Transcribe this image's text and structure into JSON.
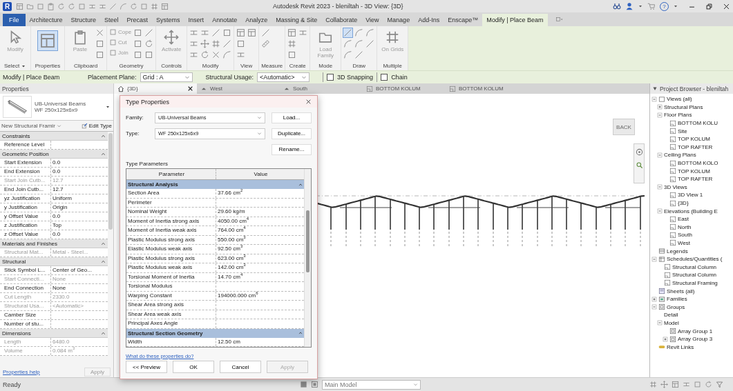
{
  "title_bar": {
    "logo": "R",
    "title": "Autodesk Revit 2023 - bleniltah - 3D View: {3D}",
    "help": "?"
  },
  "ribbon_tabs": [
    {
      "label": "File",
      "kind": "file",
      "selected": false
    },
    {
      "label": "Architecture",
      "kind": "tab",
      "selected": false
    },
    {
      "label": "Structure",
      "kind": "tab",
      "selected": false
    },
    {
      "label": "Steel",
      "kind": "tab",
      "selected": false
    },
    {
      "label": "Precast",
      "kind": "tab",
      "selected": false
    },
    {
      "label": "Systems",
      "kind": "tab",
      "selected": false
    },
    {
      "label": "Insert",
      "kind": "tab",
      "selected": false
    },
    {
      "label": "Annotate",
      "kind": "tab",
      "selected": false
    },
    {
      "label": "Analyze",
      "kind": "tab",
      "selected": false
    },
    {
      "label": "Massing & Site",
      "kind": "tab",
      "selected": false
    },
    {
      "label": "Collaborate",
      "kind": "tab",
      "selected": false
    },
    {
      "label": "View",
      "kind": "tab",
      "selected": false
    },
    {
      "label": "Manage",
      "kind": "tab",
      "selected": false
    },
    {
      "label": "Add-Ins",
      "kind": "tab",
      "selected": false
    },
    {
      "label": "Enscape™",
      "kind": "tab",
      "selected": false
    },
    {
      "label": "Modify | Place Beam",
      "kind": "context",
      "selected": true
    }
  ],
  "ribbon_panels": [
    {
      "label": "Select",
      "dropdown": true,
      "buttons": [
        {
          "label": "Modify",
          "disabled": true
        }
      ]
    },
    {
      "label": "Properties",
      "dropdown": false
    },
    {
      "label": "Clipboard",
      "dropdown": false,
      "buttons": [
        {
          "label": "Paste",
          "disabled": true
        }
      ]
    },
    {
      "label": "Geometry",
      "dropdown": false,
      "buttons": [
        {
          "label": "Cope",
          "disabled": true
        },
        {
          "label": "Cut",
          "disabled": true
        },
        {
          "label": "Join",
          "disabled": true
        }
      ]
    },
    {
      "label": "Controls",
      "dropdown": false,
      "buttons": [
        {
          "label": "Activate",
          "disabled": true
        }
      ]
    },
    {
      "label": "Modify",
      "dropdown": false
    },
    {
      "label": "View",
      "dropdown": false
    },
    {
      "label": "Measure",
      "dropdown": false
    },
    {
      "label": "Create",
      "dropdown": false
    },
    {
      "label": "Mode",
      "dropdown": false,
      "buttons": [
        {
          "label": "Load Family",
          "disabled": true
        }
      ]
    },
    {
      "label": "Draw",
      "dropdown": false
    },
    {
      "label": "Multiple",
      "dropdown": false,
      "buttons": [
        {
          "label": "On Grids",
          "disabled": true
        }
      ]
    }
  ],
  "options_bar": {
    "context": "Modify | Place Beam",
    "fields": [
      {
        "label": "Placement Plane:",
        "value": "Grid : A"
      },
      {
        "label": "Structural Usage:",
        "value": "<Automatic>"
      }
    ],
    "checkboxes": [
      {
        "label": "3D Snapping",
        "checked": false
      },
      {
        "label": "Chain",
        "checked": false
      }
    ]
  },
  "properties": {
    "title": "Properties",
    "type_name": "UB-Universal Beams",
    "type_size": "WF 250x125x6x9",
    "instance_filter": "New Structural Framir",
    "edit_type": "Edit Type",
    "groups": [
      {
        "label": "Constraints",
        "rows": [
          {
            "name": "Reference Level",
            "disabled": false
          }
        ]
      },
      {
        "label": "Geometric Position",
        "rows": [
          {
            "name": "Start Extension",
            "value": "0.0",
            "disabled": false
          },
          {
            "name": "End Extension",
            "value": "0.0",
            "disabled": false
          },
          {
            "name": "Start Join Cutb...",
            "value": "12.7",
            "disabled": true
          },
          {
            "name": "End Join Cutb...",
            "value": "12.7",
            "disabled": false
          },
          {
            "name": "yz Justification",
            "value": "Uniform",
            "disabled": false
          },
          {
            "name": "y Justification",
            "value": "Origin",
            "disabled": false
          },
          {
            "name": "y Offset Value",
            "value": "0.0",
            "disabled": false
          },
          {
            "name": "z Justification",
            "value": "Top",
            "disabled": false
          },
          {
            "name": "z Offset Value",
            "value": "0.0",
            "disabled": false
          }
        ]
      },
      {
        "label": "Materials and Finishes",
        "rows": [
          {
            "name": "Structural Mat...",
            "value": "Metal - Steel...",
            "disabled": true
          }
        ]
      },
      {
        "label": "Structural",
        "rows": [
          {
            "name": "Stick Symbol L...",
            "value": "Center of Geo...",
            "disabled": false
          },
          {
            "name": "Start Connecti...",
            "value": "None",
            "disabled": true
          },
          {
            "name": "End Connection",
            "value": "None",
            "disabled": false
          },
          {
            "name": "Cut Length",
            "value": "2330.0",
            "disabled": true
          },
          {
            "name": "Structural Usa...",
            "value": "<Automatic>",
            "disabled": true
          },
          {
            "name": "Camber Size",
            "disabled": false
          },
          {
            "name": "Number of stu...",
            "disabled": false
          }
        ]
      },
      {
        "label": "Dimensions",
        "rows": [
          {
            "name": "Length",
            "value": "6480.0",
            "disabled": true
          },
          {
            "name": "Volume",
            "value": "0.084 m$^{3}$",
            "disabled": true
          }
        ]
      }
    ],
    "help_link": "Properties help",
    "apply": "Apply"
  },
  "view_tabs": [
    {
      "label": "{3D}",
      "kind": "perspective",
      "selected": true
    },
    {
      "label": "West",
      "kind": "elevation",
      "selected": false
    },
    {
      "label": "South",
      "kind": "elevation",
      "selected": false
    },
    {
      "label": "BOTTOM KOLUM",
      "kind": "plan",
      "selected": false
    },
    {
      "label": "BOTTOM KOLUM",
      "kind": "plan",
      "selected": false
    }
  ],
  "view": {
    "view_cube": "BACK"
  },
  "type_dialog": {
    "title": "Type Properties",
    "family_label": "Family:",
    "family": "UB-Universal Beams",
    "type_label": "Type:",
    "type": "WF 250x125x6x9",
    "buttons": [
      "Load...",
      "Duplicate...",
      "Rename..."
    ],
    "section_label": "Type Parameters",
    "columns": [
      "Parameter",
      "Value"
    ],
    "groups": [
      {
        "label": "Structural Analysis",
        "rows": [
          {
            "name": "Section Area",
            "value": "37.66 cm$^{2}$"
          },
          {
            "name": "Perimeter"
          },
          {
            "name": "Nominal Weight",
            "value": "29.60 kg/m"
          },
          {
            "name": "Moment of Inertia strong axis",
            "value": "4050.00 cm$^{4}$"
          },
          {
            "name": "Moment of Inertia weak axis",
            "value": "764.00 cm$^{4}$"
          },
          {
            "name": "Plastic Modulus strong axis",
            "value": "550.00 cm$^{3}$"
          },
          {
            "name": "Elastic Modulus weak axis",
            "value": "92.50 cm$^{3}$"
          },
          {
            "name": "Plastic Modulus strong axis",
            "value": "623.00 cm$^{3}$"
          },
          {
            "name": "Plastic Modulus weak axis",
            "value": "142.00 cm$^{3}$"
          },
          {
            "name": "Torsional Moment of Inertia",
            "value": "14.70 cm$^{4}$"
          },
          {
            "name": "Torsional Modulus"
          },
          {
            "name": "Warping Constant",
            "value": "194000.000 cm$^{6}$"
          },
          {
            "name": "Shear Area strong axis"
          },
          {
            "name": "Shear Area weak axis"
          },
          {
            "name": "Principal Axes Angle"
          }
        ]
      },
      {
        "label": "Structural Section Geometry",
        "rows": [
          {
            "name": "Width",
            "value": "12.50 cm"
          }
        ]
      }
    ],
    "help_link": "What do these properties do?",
    "footer_buttons": [
      {
        "label": "<< Preview",
        "disabled": false
      },
      {
        "label": "OK",
        "disabled": false
      },
      {
        "label": "Cancel",
        "disabled": false
      },
      {
        "label": "Apply",
        "disabled": true
      }
    ]
  },
  "project_browser": {
    "title": "Project Browser - bleniltah",
    "tree": [
      {
        "label": "Views (all)",
        "kind": "views",
        "expanded": true,
        "children": [
          {
            "label": "Structural Plans",
            "kind": "folder",
            "expanded": false
          },
          {
            "label": "Floor Plans",
            "kind": "folder",
            "expanded": true,
            "children": [
              {
                "label": "BOTTOM KOLU",
                "kind": "view"
              },
              {
                "label": "Site",
                "kind": "view"
              },
              {
                "label": "TOP KOLUM",
                "kind": "view"
              },
              {
                "label": "TOP RAFTER",
                "kind": "view"
              }
            ]
          },
          {
            "label": "Ceiling Plans",
            "kind": "folder",
            "expanded": true,
            "children": [
              {
                "label": "BOTTOM KOLO",
                "kind": "view"
              },
              {
                "label": "TOP KOLUM",
                "kind": "view"
              },
              {
                "label": "TOP RAFTER",
                "kind": "view"
              }
            ]
          },
          {
            "label": "3D Views",
            "kind": "folder",
            "expanded": true,
            "children": [
              {
                "label": "3D View 1",
                "kind": "view"
              },
              {
                "label": "{3D}",
                "kind": "view"
              }
            ]
          },
          {
            "label": "Elevations (Building E",
            "kind": "folder",
            "expanded": true,
            "children": [
              {
                "label": "East",
                "kind": "view"
              },
              {
                "label": "North",
                "kind": "view"
              },
              {
                "label": "South",
                "kind": "view"
              },
              {
                "label": "West",
                "kind": "view"
              }
            ]
          }
        ]
      },
      {
        "label": "Legends",
        "kind": "legend"
      },
      {
        "label": "Schedules/Quantities (",
        "kind": "schedule",
        "expanded": true,
        "children": [
          {
            "label": "Structural Column",
            "kind": "view"
          },
          {
            "label": "Structural Column",
            "kind": "view"
          },
          {
            "label": "Structural Framing",
            "kind": "view"
          }
        ]
      },
      {
        "label": "Sheets (all)",
        "kind": "sheet"
      },
      {
        "label": "Families",
        "kind": "family",
        "expanded": false
      },
      {
        "label": "Groups",
        "kind": "group",
        "expanded": true,
        "children": [
          {
            "label": "Detail",
            "kind": "folder"
          },
          {
            "label": "Model",
            "kind": "folder",
            "expanded": true,
            "children": [
              {
                "label": "Array Group 1",
                "kind": "group"
              },
              {
                "label": "Array Group 3",
                "kind": "group",
                "expanded": false
              }
            ]
          }
        ]
      },
      {
        "label": "Revit Links",
        "kind": "link"
      }
    ]
  },
  "status_bar": {
    "status": "Ready",
    "workset": "Main Model"
  }
}
